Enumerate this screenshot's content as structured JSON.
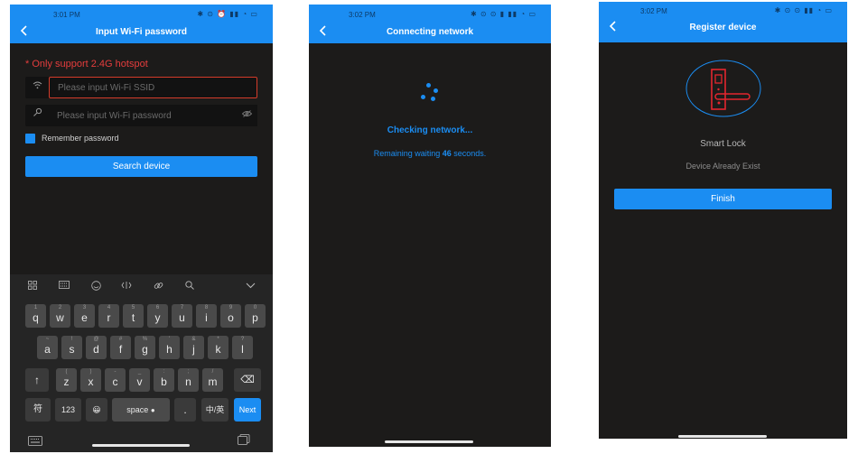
{
  "screen1": {
    "status_time": "3:01 PM",
    "status_icons": "✱ ⊙ ⏰ ▮▮ ◔ ▭",
    "title": "Input Wi-Fi password",
    "back_icon": "chevron-left",
    "warning": "* Only support 2.4G hotspot",
    "ssid_placeholder": "Please input Wi-Fi SSID",
    "password_placeholder": "Please input Wi-Fi password",
    "remember_label": "Remember password",
    "search_button": "Search device",
    "keyboard": {
      "toolbar_icons": [
        "grid-icon",
        "keyboard-layout-icon",
        "emoji-icon",
        "cursor-icon",
        "link-icon",
        "search-icon",
        "collapse-icon"
      ],
      "row1": [
        "q",
        "w",
        "e",
        "r",
        "t",
        "y",
        "u",
        "i",
        "o",
        "p"
      ],
      "row1_sub": [
        "1",
        "2",
        "3",
        "4",
        "5",
        "6",
        "7",
        "8",
        "9",
        "0"
      ],
      "row2": [
        "a",
        "s",
        "d",
        "f",
        "g",
        "h",
        "j",
        "k",
        "l"
      ],
      "row2_sub": [
        "~",
        "!",
        "@",
        "#",
        "%",
        "'",
        "&",
        "*",
        "?"
      ],
      "row3": [
        "z",
        "x",
        "c",
        "v",
        "b",
        "n",
        "m"
      ],
      "row3_sub": [
        "(",
        ")",
        "-",
        "_",
        ":",
        ";",
        "/"
      ],
      "shift": "↑",
      "backspace": "⌫",
      "symbols": "符",
      "numbers": "123",
      "emoji_key": "😀",
      "space": "space",
      "period": ".",
      "lang": "中/英",
      "next": "Next"
    }
  },
  "screen2": {
    "status_time": "3:02 PM",
    "status_icons": "✱ ⊙ ⊙ ▮ ▮▮ ◔ ▭",
    "title": "Connecting network",
    "checking": "Checking network...",
    "remaining_prefix": "Remaining waiting ",
    "remaining_seconds": "46",
    "remaining_suffix": " seconds."
  },
  "screen3": {
    "status_time": "3:02 PM",
    "status_icons": "✱ ⊙ ⊙ ▮▮ ◔ ▭",
    "title": "Register device",
    "device_name": "Smart Lock",
    "device_status": "Device Already Exist",
    "finish_button": "Finish"
  },
  "colors": {
    "accent": "#1b8df2",
    "background": "#1c1b1a",
    "warning": "#e53d3d",
    "lock": "#e3262e"
  }
}
